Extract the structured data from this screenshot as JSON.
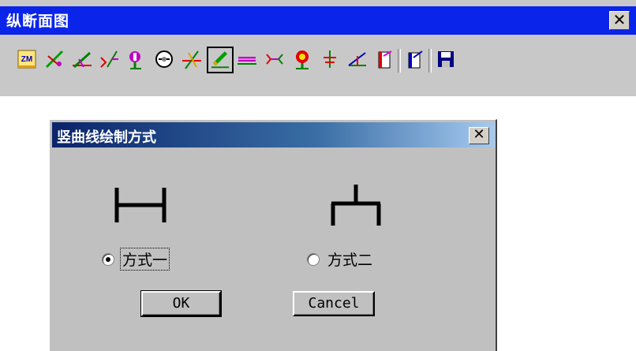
{
  "toolbar": {
    "title": "纵断面图",
    "close_label": "✕",
    "buttons": [
      {
        "name": "zm-icon",
        "label": "ZM"
      },
      {
        "name": "diagonal-pencil-icon",
        "label": ""
      },
      {
        "name": "slope-grid-icon",
        "label": ""
      },
      {
        "name": "curve-point-icon",
        "label": ""
      },
      {
        "name": "station-marker-icon",
        "label": ""
      },
      {
        "name": "circle-cross-icon",
        "label": ""
      },
      {
        "name": "angle-grid-icon",
        "label": ""
      },
      {
        "name": "draw-curve-icon",
        "label": "",
        "pressed": true
      },
      {
        "name": "bridge-icon",
        "label": ""
      },
      {
        "name": "culvert-icon",
        "label": ""
      },
      {
        "name": "red-marker-icon",
        "label": ""
      },
      {
        "name": "level-cross-icon",
        "label": ""
      },
      {
        "name": "angle-line-icon",
        "label": ""
      },
      {
        "name": "table-icon",
        "label": ""
      },
      {
        "name": "export-table-icon",
        "label": ""
      },
      {
        "name": "save-disk-icon",
        "label": ""
      }
    ]
  },
  "dialog": {
    "title": "竖曲线绘制方式",
    "close_label": "✕",
    "options": [
      {
        "label": "方式一",
        "selected": true
      },
      {
        "label": "方式二",
        "selected": false
      }
    ],
    "ok_label": "OK",
    "cancel_label": "Cancel"
  },
  "colors": {
    "titlebar": "#0a24ea",
    "dialog_title_start": "#0a246a",
    "dialog_title_end": "#a6caf0",
    "face": "#c0c0c0"
  }
}
